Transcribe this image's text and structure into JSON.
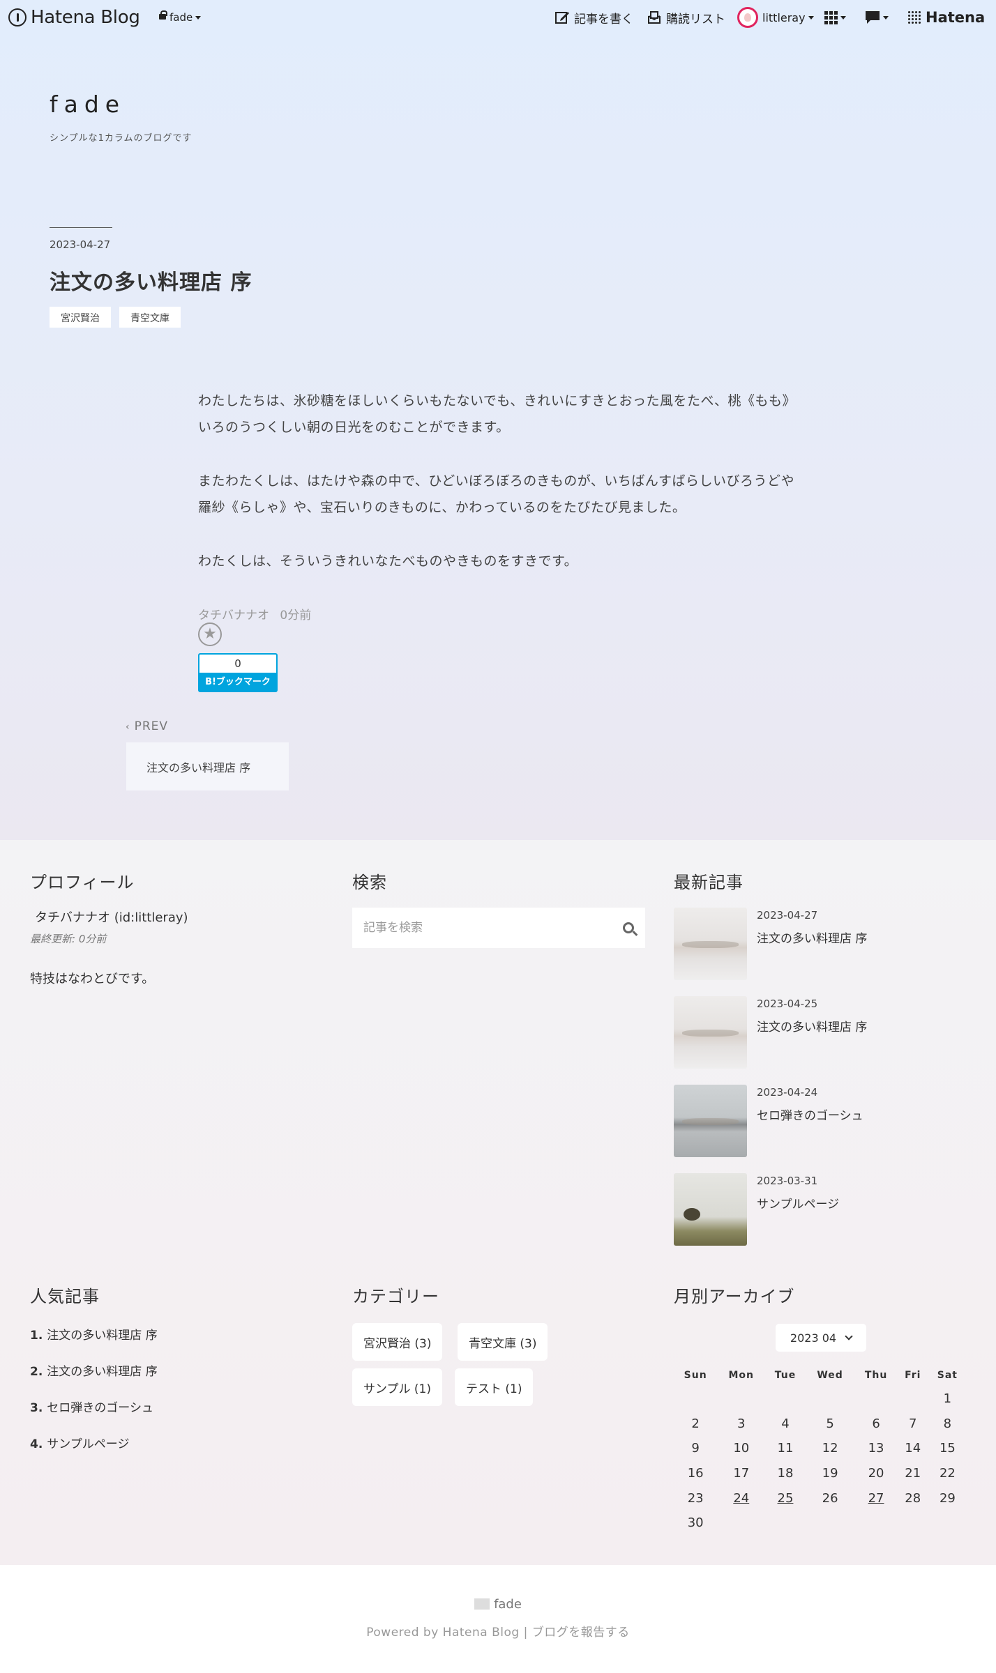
{
  "topbar": {
    "brand": "Hatena Blog",
    "blog_switch": "fade",
    "write_label": "記事を書く",
    "subscribe_label": "購読リスト",
    "user": "littleray",
    "hatena_label": "Hatena"
  },
  "header": {
    "title": "fade",
    "description": "シンプルな1カラムのブログです"
  },
  "article": {
    "date": "2023-04-27",
    "title": "注文の多い料理店 序",
    "tags": [
      "宮沢賢治",
      "青空文庫"
    ],
    "paragraphs": [
      "わたしたちは、氷砂糖をほしいくらいもたないでも、きれいにすきとおった風をたべ、桃《もも》いろのうつくしい朝の日光をのむことができます。",
      "またわたくしは、はたけや森の中で、ひどいぼろぼろのきものが、いちばんすばらしいびろうどや羅紗《らしゃ》や、宝石いりのきものに、かわっているのをたびたび見ました。",
      "わたくしは、そういうきれいなたべものやきものをすきです。"
    ],
    "author": "タチバナナオ",
    "time_ago": "0分前",
    "bookmark_count": "0",
    "bookmark_label": "B!ブックマーク"
  },
  "pager": {
    "prev_label": "PREV",
    "prev_title": "注文の多い料理店 序"
  },
  "widgets": {
    "profile": {
      "title": "プロフィール",
      "name": "タチバナナオ (id:littleray)",
      "updated": "最終更新: 0分前",
      "bio": "特技はなわとびです。"
    },
    "search": {
      "title": "検索",
      "placeholder": "記事を検索"
    },
    "recent": {
      "title": "最新記事",
      "items": [
        {
          "date": "2023-04-27",
          "title": "注文の多い料理店 序"
        },
        {
          "date": "2023-04-25",
          "title": "注文の多い料理店 序"
        },
        {
          "date": "2023-04-24",
          "title": "セロ弾きのゴーシュ"
        },
        {
          "date": "2023-03-31",
          "title": "サンプルページ"
        }
      ]
    },
    "popular": {
      "title": "人気記事",
      "items": [
        {
          "rank": "1.",
          "title": "注文の多い料理店 序"
        },
        {
          "rank": "2.",
          "title": "注文の多い料理店 序"
        },
        {
          "rank": "3.",
          "title": "セロ弾きのゴーシュ"
        },
        {
          "rank": "4.",
          "title": "サンプルページ"
        }
      ]
    },
    "categories": {
      "title": "カテゴリー",
      "items": [
        "宮沢賢治 (3)",
        "青空文庫 (3)",
        "サンプル (1)",
        "テスト (1)"
      ]
    },
    "archive": {
      "title": "月別アーカイブ",
      "selected_month": "2023 04",
      "weekdays": [
        "Sun",
        "Mon",
        "Tue",
        "Wed",
        "Thu",
        "Fri",
        "Sat"
      ],
      "weeks": [
        [
          "",
          "",
          "",
          "",
          "",
          "",
          "1"
        ],
        [
          "2",
          "3",
          "4",
          "5",
          "6",
          "7",
          "8"
        ],
        [
          "9",
          "10",
          "11",
          "12",
          "13",
          "14",
          "15"
        ],
        [
          "16",
          "17",
          "18",
          "19",
          "20",
          "21",
          "22"
        ],
        [
          "23",
          "24",
          "25",
          "26",
          "27",
          "28",
          "29"
        ],
        [
          "30",
          "",
          "",
          "",
          "",
          "",
          ""
        ]
      ],
      "linked_days": [
        "24",
        "25",
        "27"
      ]
    }
  },
  "footer": {
    "blog_name": "fade",
    "powered": "Powered by Hatena Blog",
    "separator": "|",
    "report": "ブログを報告する"
  },
  "colors": {
    "bookmark_blue": "#00a4de",
    "avatar_ring": "#e0245e"
  }
}
